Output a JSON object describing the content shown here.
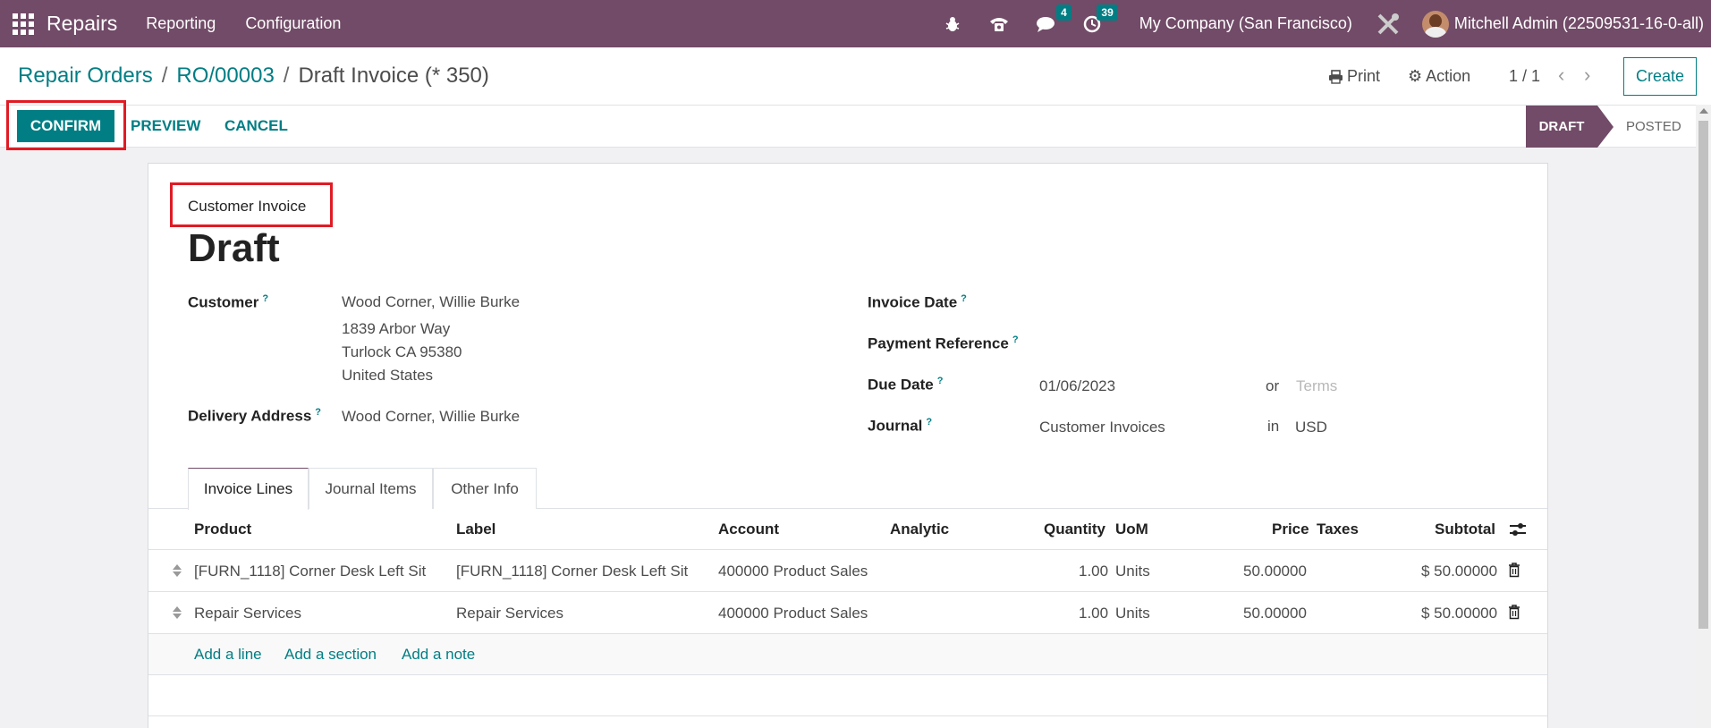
{
  "navbar": {
    "app_name": "Repairs",
    "menus": [
      "Reporting",
      "Configuration"
    ],
    "messages_badge": "4",
    "activities_badge": "39",
    "company": "My Company (San Francisco)",
    "user": "Mitchell Admin (22509531-16-0-all)",
    "color": "#714b67"
  },
  "breadcrumb": {
    "root": "Repair Orders",
    "parent": "RO/00003",
    "current": "Draft Invoice (* 350)"
  },
  "control": {
    "print_label": "Print",
    "action_label": "Action",
    "pager": "1 / 1",
    "create_label": "Create"
  },
  "statusbar": {
    "confirm_label": "CONFIRM",
    "preview_label": "PREVIEW",
    "cancel_label": "CANCEL",
    "stages": [
      "DRAFT",
      "POSTED"
    ],
    "active_stage": "DRAFT"
  },
  "invoice": {
    "type": "Customer Invoice",
    "title": "Draft",
    "customer_label": "Customer",
    "customer_lines": [
      "Wood Corner, Willie Burke",
      "1839 Arbor Way",
      "Turlock CA 95380",
      "United States"
    ],
    "delivery_label": "Delivery Address",
    "delivery_value": "Wood Corner, Willie Burke",
    "invoice_date_label": "Invoice Date",
    "payment_ref_label": "Payment Reference",
    "due_date_label": "Due Date",
    "due_date_value": "01/06/2023",
    "due_or": "or",
    "terms_placeholder": "Terms",
    "journal_label": "Journal",
    "journal_value": "Customer Invoices",
    "journal_in": "in",
    "currency": "USD",
    "help_mark": "?"
  },
  "tabs": [
    "Invoice Lines",
    "Journal Items",
    "Other Info"
  ],
  "table": {
    "headers": {
      "product": "Product",
      "label": "Label",
      "account": "Account",
      "analytic": "Analytic",
      "quantity": "Quantity",
      "uom": "UoM",
      "price": "Price",
      "taxes": "Taxes",
      "subtotal": "Subtotal"
    },
    "rows": [
      {
        "product": "[FURN_1118] Corner Desk Left Sit",
        "label": "[FURN_1118] Corner Desk Left Sit",
        "account": "400000 Product Sales",
        "quantity": "1.00",
        "uom": "Units",
        "price": "50.00000",
        "subtotal": "$ 50.00000"
      },
      {
        "product": "Repair Services",
        "label": "Repair Services",
        "account": "400000 Product Sales",
        "quantity": "1.00",
        "uom": "Units",
        "price": "50.00000",
        "subtotal": "$ 50.00000"
      }
    ],
    "add_line": "Add a line",
    "add_section": "Add a section",
    "add_note": "Add a note"
  },
  "colors": {
    "primary": "#017e84",
    "brand": "#714b67",
    "highlight": "#e01b24"
  }
}
